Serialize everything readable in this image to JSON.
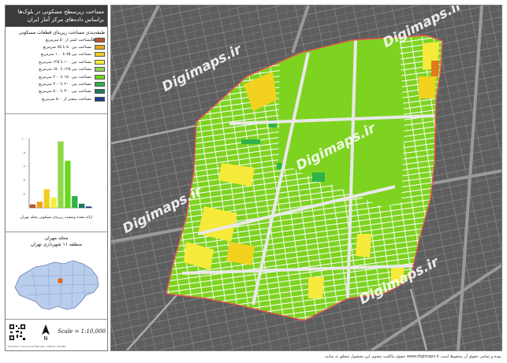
{
  "panel": {
    "title_line1": "مساحت زیرسطح مسکونی در بلوک‌ها",
    "title_line2": "براساس داده‌های مرکز آمار ایران",
    "legend_header": "طبقه‌بندی مساحت زیربنای قطعات مسکونی بلوک‌ها",
    "legend": [
      {
        "label": "مساحت کمتر از ۵۰ مترمربع",
        "color": "#b5562a"
      },
      {
        "label": "مساحت بین ۵۰ تا ۷۵ مترمربع",
        "color": "#e8a51c"
      },
      {
        "label": "مساحت بین ۷۵ تا ۱۰۰ مترمربع",
        "color": "#f2cc22"
      },
      {
        "label": "مساحت بین ۱۰۰ تا ۱۲۵ مترمربع",
        "color": "#f6ef3c"
      },
      {
        "label": "مساحت بین ۱۲۵ تا ۱۵۰ مترمربع",
        "color": "#8fd84a"
      },
      {
        "label": "مساحت بین ۱۵۰ تا ۲۰۰ مترمربع",
        "color": "#6cd61c"
      },
      {
        "label": "مساحت بین ۲۰۰ تا ۳۰۰ مترمربع",
        "color": "#2fb24a"
      },
      {
        "label": "مساحت بین ۳۰۰ تا ۵۰۰ مترمربع",
        "color": "#1a7a5e"
      },
      {
        "label": "مساحت بیشتر از ۵۰۰ مترمربع",
        "color": "#1d3f8e"
      }
    ],
    "chart_caption": "ارائه دهنده وضعیت زیربنای مسکونی محله مهران"
  },
  "chart_data": {
    "type": "bar",
    "categories": [
      "1",
      "2",
      "3",
      "4",
      "5",
      "6",
      "7",
      "8",
      "9"
    ],
    "values": [
      5,
      9,
      27,
      15,
      96,
      68,
      17,
      6,
      2
    ],
    "colors": [
      "#b5562a",
      "#e8a51c",
      "#f2cc22",
      "#f6ef3c",
      "#8fd84a",
      "#6cd61c",
      "#2fb24a",
      "#1a7a5e",
      "#1d3f8e"
    ],
    "ylim": [
      0,
      100
    ],
    "yticks": [
      "۰",
      "۲۰",
      "۴۰",
      "۶۰",
      "۸۰",
      "۱۰۰"
    ]
  },
  "locator": {
    "title": "محله مهران",
    "subtitle": "منطقه ۱۱ شهرداری تهران"
  },
  "scale": {
    "text": "Scale = 1:10,000"
  },
  "credits": "Projection: Transverse Mercator / Datum: WGS84",
  "map": {
    "watermark": "Digimaps.ir"
  },
  "footer": "حقوق مالکیت معنوی این محصول متعلق به سایت www.digimaps.ir بوده و تمامی حقوق آن محفوظ است."
}
